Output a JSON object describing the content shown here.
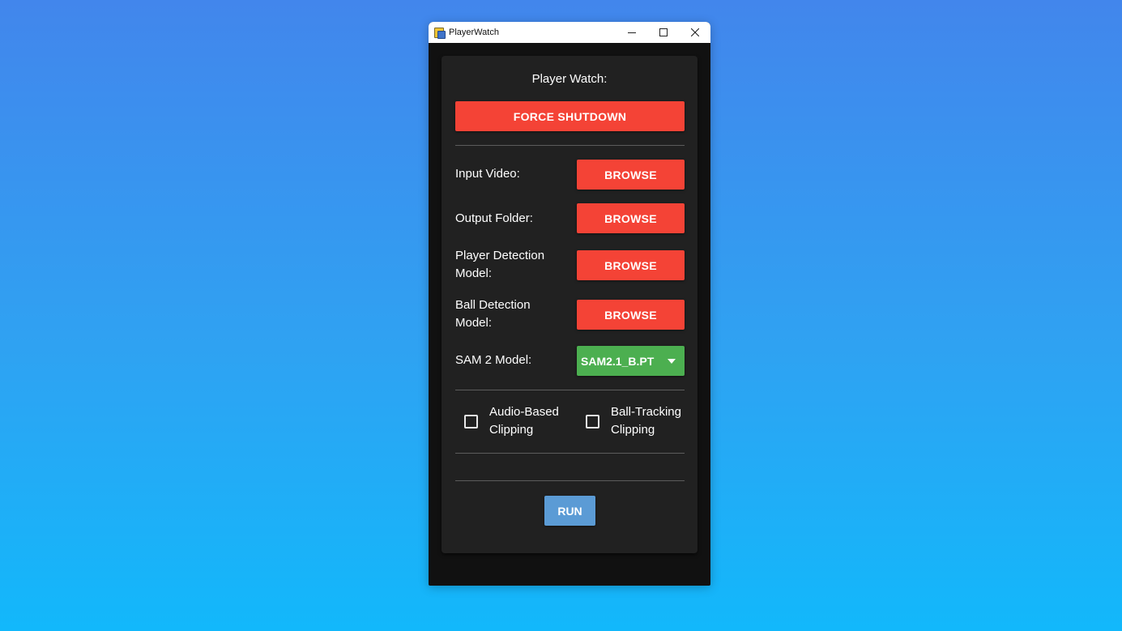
{
  "window": {
    "title": "PlayerWatch"
  },
  "panel": {
    "title": "Player Watch:",
    "force_shutdown_label": "FORCE SHUTDOWN",
    "rows": [
      {
        "label": "Input Video:",
        "button": "BROWSE"
      },
      {
        "label": "Output Folder:",
        "button": "BROWSE"
      },
      {
        "label": "Player Detection Model:",
        "button": "BROWSE"
      },
      {
        "label": "Ball Detection Model:",
        "button": "BROWSE"
      }
    ],
    "sam_label": "SAM 2 Model:",
    "sam_selected": "SAM2.1_B.PT",
    "checkboxes": [
      {
        "label": "Audio-Based Clipping",
        "checked": false
      },
      {
        "label": "Ball-Tracking Clipping",
        "checked": false
      }
    ],
    "run_label": "RUN"
  },
  "colors": {
    "accent_red": "#f44336",
    "accent_green": "#4caf50",
    "run_blue": "#5b9bd5",
    "panel_bg": "#212121"
  },
  "icons": {
    "app": "app-icon",
    "minimize": "minimize-icon",
    "maximize": "maximize-icon",
    "close": "close-icon",
    "dropdown": "chevron-down-icon"
  }
}
